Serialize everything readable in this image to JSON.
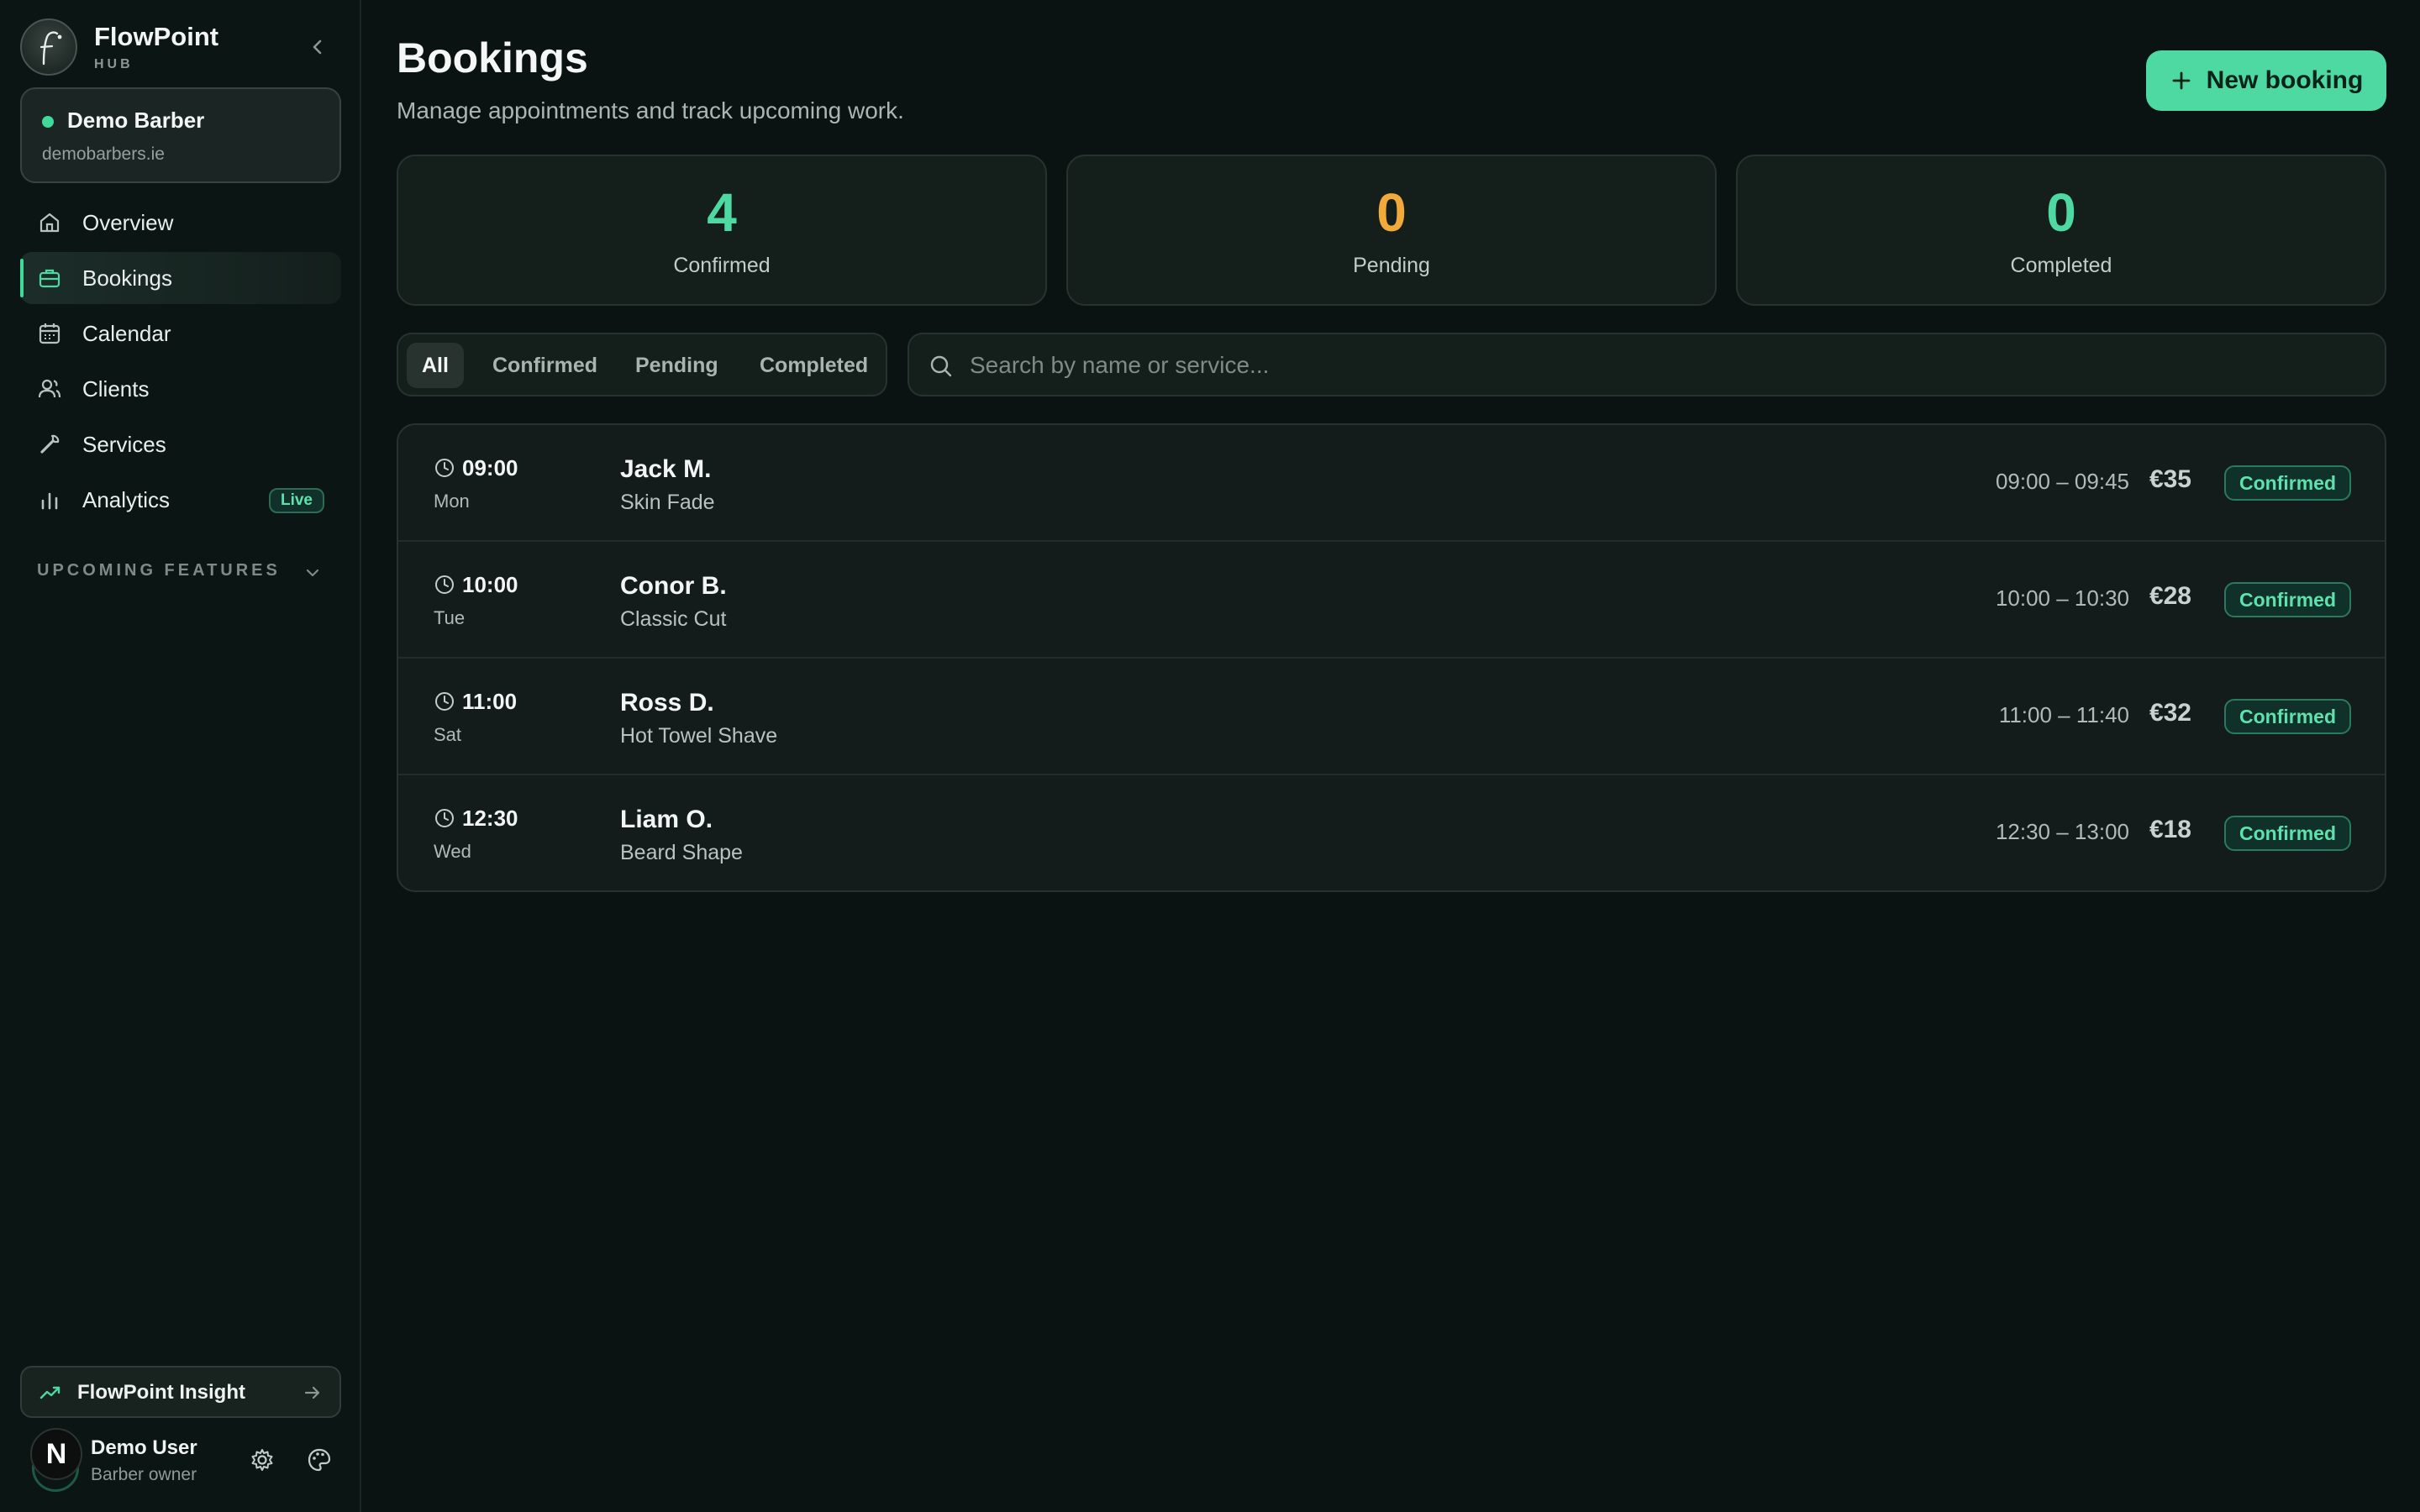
{
  "brand": {
    "name": "FlowPoint",
    "sub": "HUB"
  },
  "workspace": {
    "name": "Demo Barber",
    "url": "demobarbers.ie"
  },
  "nav": [
    {
      "label": "Overview",
      "icon": "home-icon"
    },
    {
      "label": "Bookings",
      "icon": "briefcase-icon",
      "active": true
    },
    {
      "label": "Calendar",
      "icon": "calendar-icon"
    },
    {
      "label": "Clients",
      "icon": "users-icon"
    },
    {
      "label": "Services",
      "icon": "wrench-icon"
    },
    {
      "label": "Analytics",
      "icon": "bar-chart-icon",
      "badge": "Live"
    }
  ],
  "upcoming_label": "UPCOMING FEATURES",
  "insight_label": "FlowPoint Insight",
  "user": {
    "initial": "N",
    "name": "Demo User",
    "role": "Barber owner"
  },
  "page": {
    "title": "Bookings",
    "subtitle": "Manage appointments and track upcoming work.",
    "new_button": "New booking"
  },
  "stats": [
    {
      "value": "4",
      "label": "Confirmed",
      "color": "#4dd9a1"
    },
    {
      "value": "0",
      "label": "Pending",
      "color": "#f2a93b"
    },
    {
      "value": "0",
      "label": "Completed",
      "color": "#4dd9a1"
    }
  ],
  "filters": [
    "All",
    "Confirmed",
    "Pending",
    "Completed"
  ],
  "search": {
    "placeholder": "Search by name or service..."
  },
  "bookings": [
    {
      "time": "09:00",
      "day": "Mon",
      "name": "Jack M.",
      "service": "Skin Fade",
      "range": "09:00 – 09:45",
      "price": "€35",
      "status": "Confirmed"
    },
    {
      "time": "10:00",
      "day": "Tue",
      "name": "Conor B.",
      "service": "Classic Cut",
      "range": "10:00 – 10:30",
      "price": "€28",
      "status": "Confirmed"
    },
    {
      "time": "11:00",
      "day": "Sat",
      "name": "Ross D.",
      "service": "Hot Towel Shave",
      "range": "11:00 – 11:40",
      "price": "€32",
      "status": "Confirmed"
    },
    {
      "time": "12:30",
      "day": "Wed",
      "name": "Liam O.",
      "service": "Beard Shape",
      "range": "12:30 – 13:00",
      "price": "€18",
      "status": "Confirmed"
    }
  ],
  "colors": {
    "accent": "#4dd9a1",
    "pending": "#f2a93b",
    "background": "#0a1311"
  }
}
